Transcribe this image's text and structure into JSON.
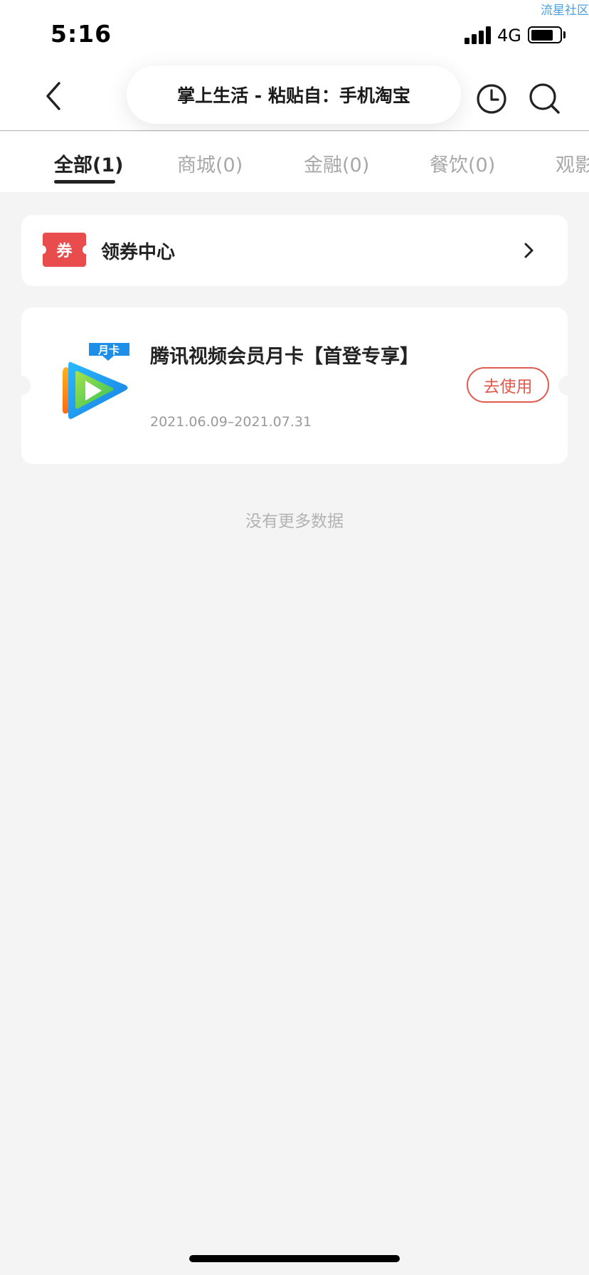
{
  "status_bar": {
    "time": "5:16",
    "network": "4G",
    "watermark": "流星社区",
    "battery_level": 0.78
  },
  "nav": {
    "title": "掌上生活 - 粘贴自：手机淘宝",
    "back_icon": "chevron-left-icon",
    "history_icon": "clock-icon",
    "search_icon": "search-icon"
  },
  "tabs": [
    {
      "label": "全部(1)",
      "active": true
    },
    {
      "label": "商城(0)",
      "active": false
    },
    {
      "label": "金融(0)",
      "active": false
    },
    {
      "label": "餐饮(0)",
      "active": false
    },
    {
      "label": "观影",
      "active": false
    }
  ],
  "coupon_center": {
    "badge": "券",
    "label": "领券中心",
    "arrow_icon": "chevron-right-icon"
  },
  "vouchers": [
    {
      "logo_badge": "月卡",
      "logo_icon": "tencent-video-icon",
      "title": "腾讯视频会员月卡【首登专享】",
      "date_range": "2021.06.09–2021.07.31",
      "action": "去使用"
    }
  ],
  "footer_text": "没有更多数据",
  "colors": {
    "accent_red": "#e84c4c",
    "button_red": "#e05a4e",
    "page_bg": "#f4f4f4"
  }
}
